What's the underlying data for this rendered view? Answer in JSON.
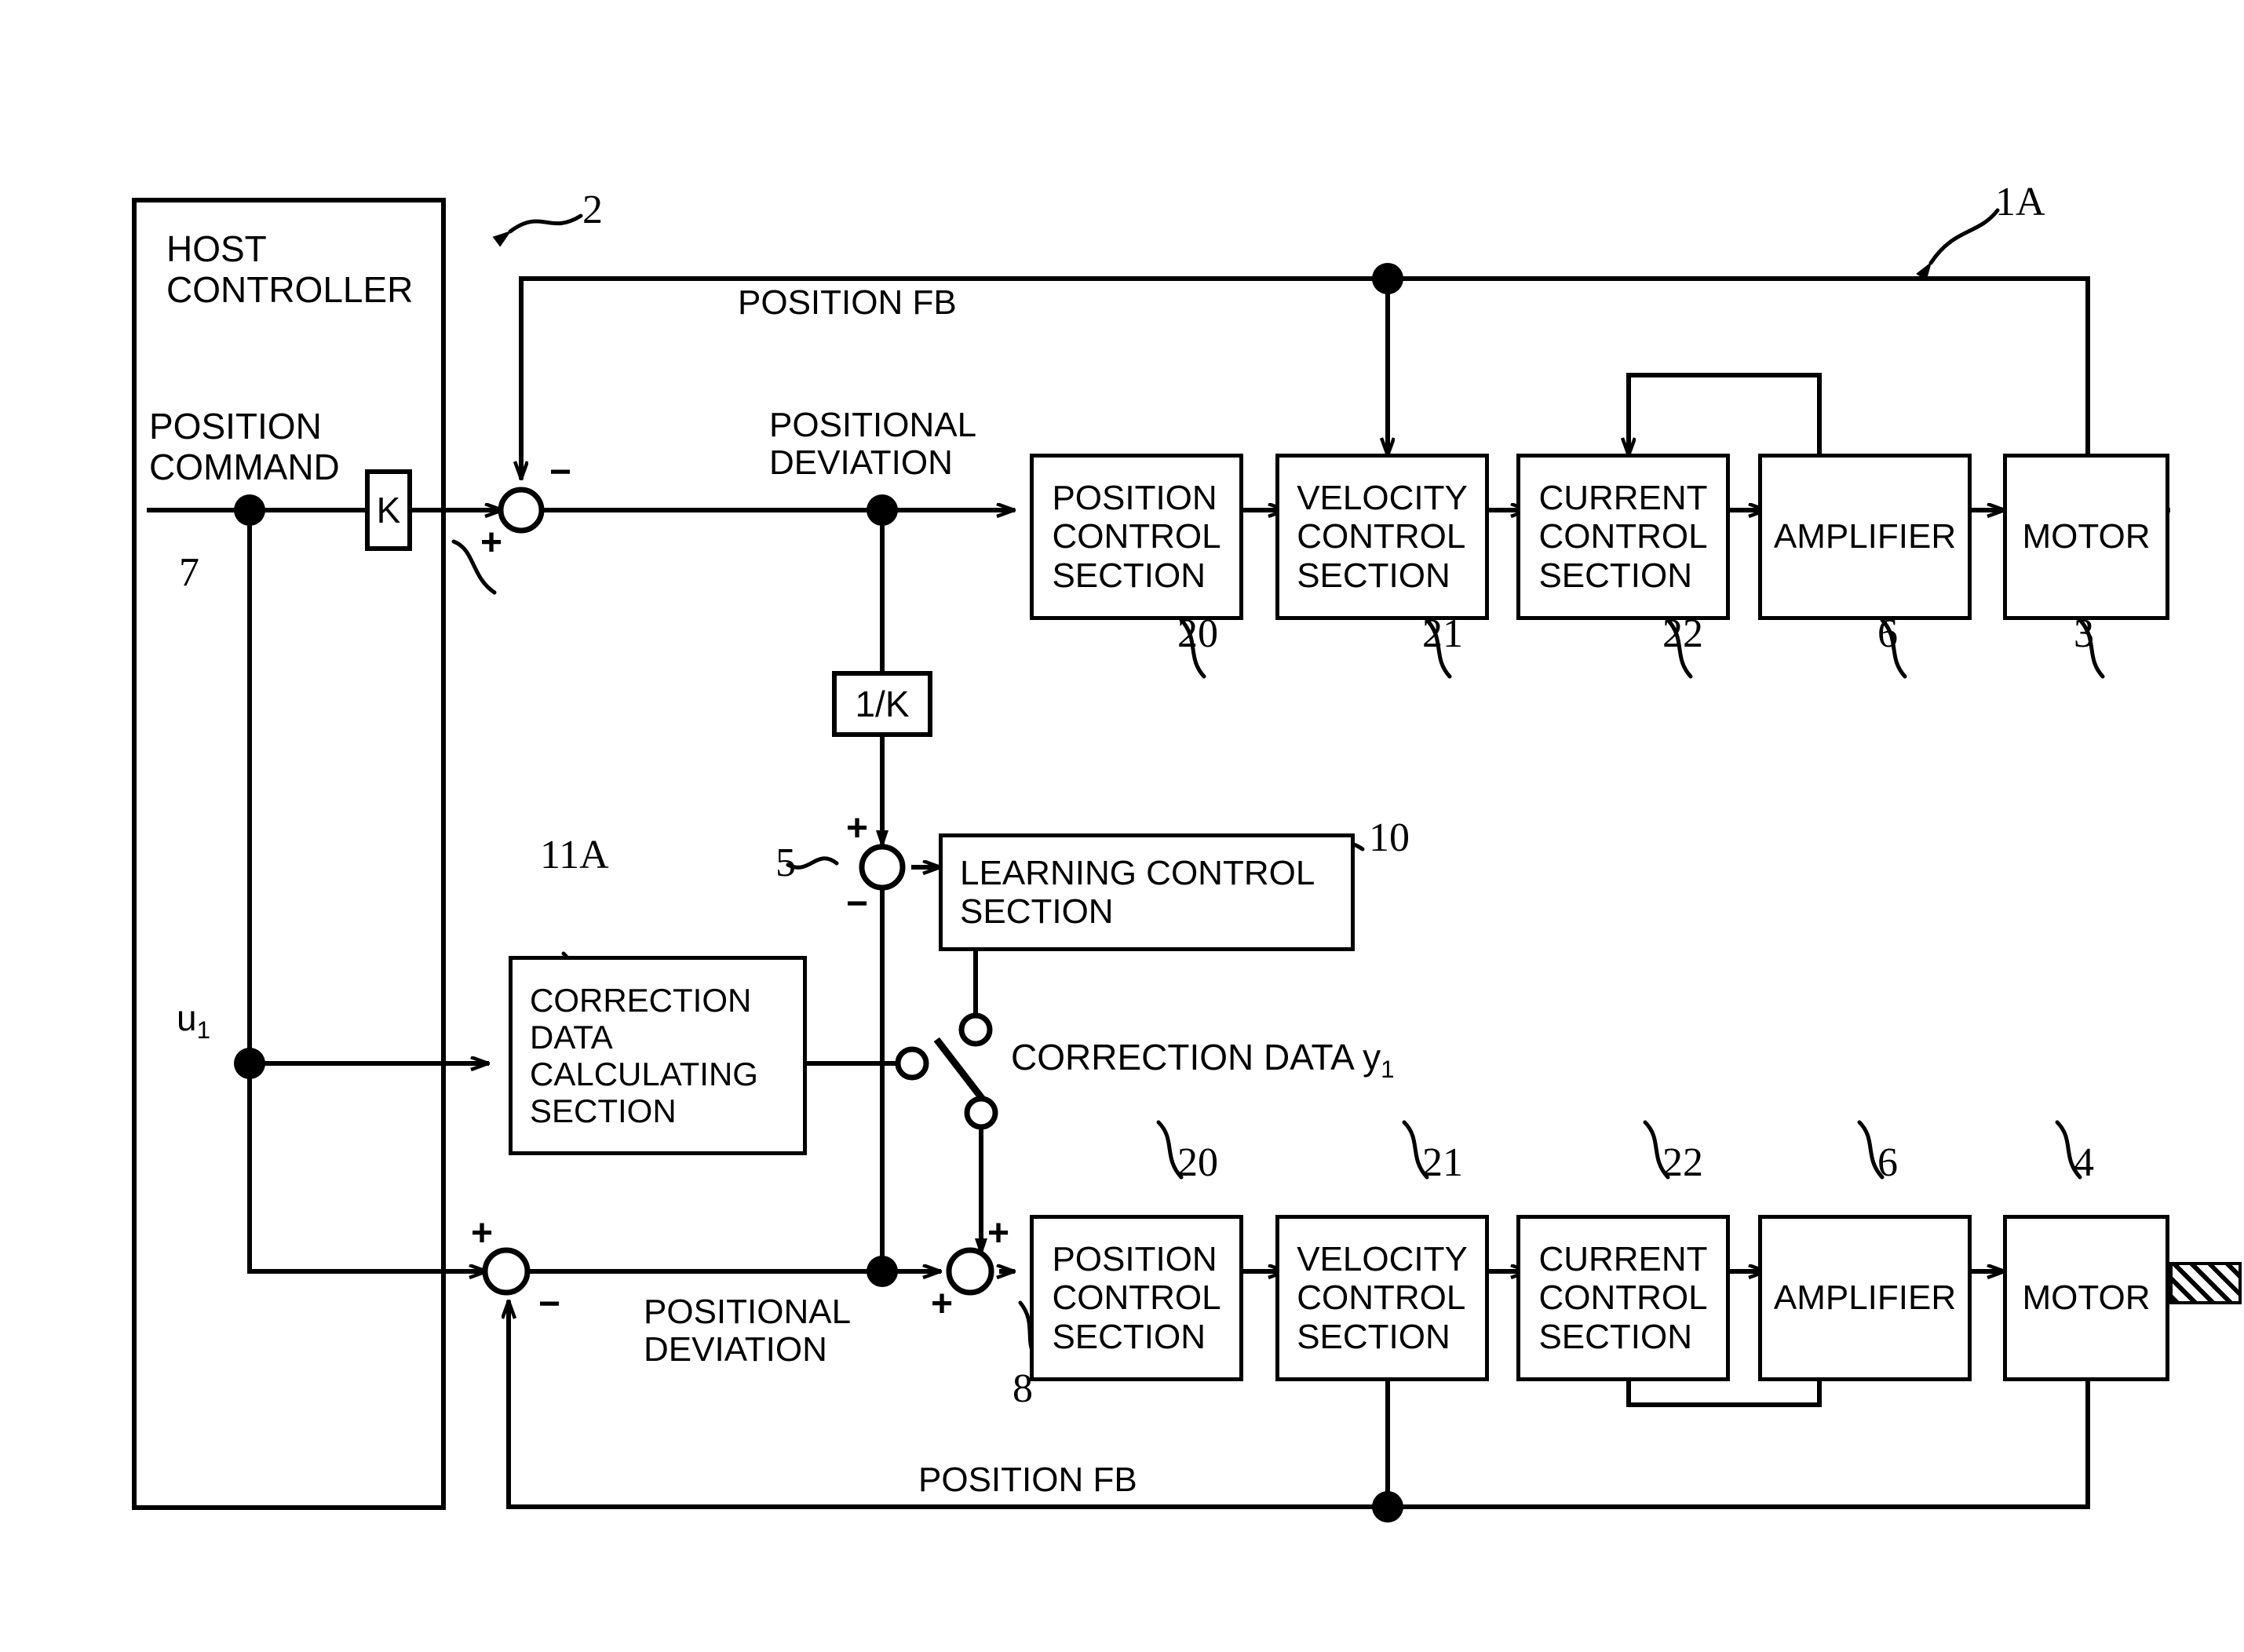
{
  "figure": {
    "ref_1A": "1A",
    "ref_2": "2",
    "ref_3": "3",
    "ref_4": "4",
    "ref_5": "5",
    "ref_6_top": "6",
    "ref_6_bottom": "6",
    "ref_7": "7",
    "ref_8": "8",
    "ref_10": "10",
    "ref_11A": "11A",
    "ref_20_top": "20",
    "ref_21_top": "21",
    "ref_22_top": "22",
    "ref_20_bottom": "20",
    "ref_21_bottom": "21",
    "ref_22_bottom": "22"
  },
  "host": {
    "title": "HOST\nCONTROLLER",
    "command_label": "POSITION\nCOMMAND",
    "u1_label": "u",
    "u1_sub": "1"
  },
  "gains": {
    "k": "K",
    "inv_k": "1/K"
  },
  "top_loop": {
    "position_fb": "POSITION FB",
    "positional_deviation": "POSITIONAL\nDEVIATION",
    "blocks": [
      {
        "name": "position-control-section",
        "label": "POSITION\nCONTROL\nSECTION",
        "ref": "20"
      },
      {
        "name": "velocity-control-section",
        "label": "VELOCITY\nCONTROL\nSECTION",
        "ref": "21"
      },
      {
        "name": "current-control-section",
        "label": "CURRENT\nCONTROL\nSECTION",
        "ref": "22"
      },
      {
        "name": "amplifier",
        "label": "AMPLIFIER",
        "ref": "6"
      },
      {
        "name": "motor",
        "label": "MOTOR",
        "ref": "3"
      }
    ]
  },
  "bottom_loop": {
    "position_fb": "POSITION FB",
    "positional_deviation": "POSITIONAL\nDEVIATION",
    "blocks": [
      {
        "name": "position-control-section",
        "label": "POSITION\nCONTROL\nSECTION",
        "ref": "20"
      },
      {
        "name": "velocity-control-section",
        "label": "VELOCITY\nCONTROL\nSECTION",
        "ref": "21"
      },
      {
        "name": "current-control-section",
        "label": "CURRENT\nCONTROL\nSECTION",
        "ref": "22"
      },
      {
        "name": "amplifier",
        "label": "AMPLIFIER",
        "ref": "6"
      },
      {
        "name": "motor",
        "label": "MOTOR",
        "ref": "4"
      }
    ]
  },
  "learning": {
    "label": "LEARNING CONTROL\nSECTION",
    "ref": "10"
  },
  "correction": {
    "calc_label": "CORRECTION\nDATA\nCALCULATING\nSECTION",
    "ref": "11A",
    "data_label": "CORRECTION DATA y",
    "data_sub": "1"
  },
  "signs": {
    "plus": "+",
    "minus": "−"
  },
  "colors": {
    "ink": "#000000",
    "paper": "#ffffff"
  }
}
